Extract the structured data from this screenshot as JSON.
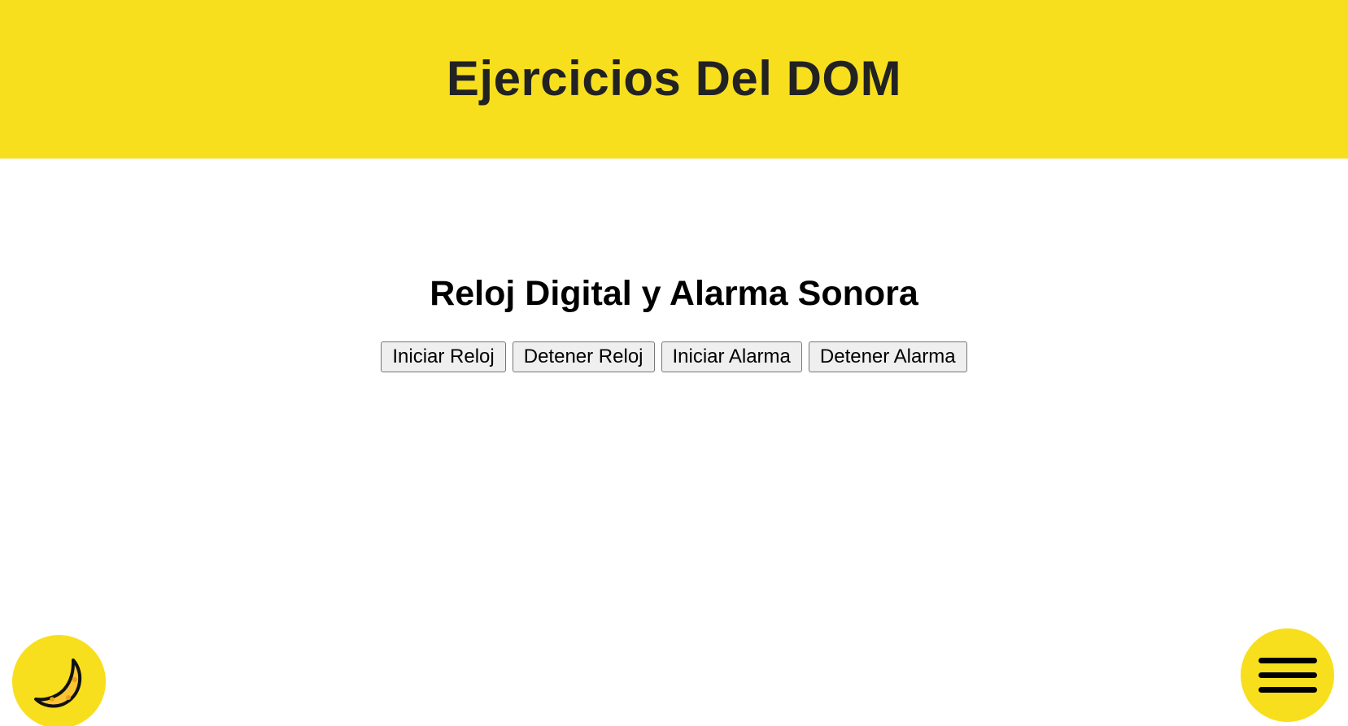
{
  "header": {
    "title": "Ejercicios Del DOM"
  },
  "section": {
    "title": "Reloj Digital y Alarma Sonora",
    "buttons": [
      {
        "label": "Iniciar Reloj"
      },
      {
        "label": "Detener Reloj"
      },
      {
        "label": "Iniciar Alarma"
      },
      {
        "label": "Detener Alarma"
      }
    ]
  },
  "controls": {
    "theme_icon": "moon-icon",
    "menu_icon": "hamburger-icon"
  },
  "colors": {
    "accent": "#f7df1e",
    "title_text": "#222222"
  }
}
